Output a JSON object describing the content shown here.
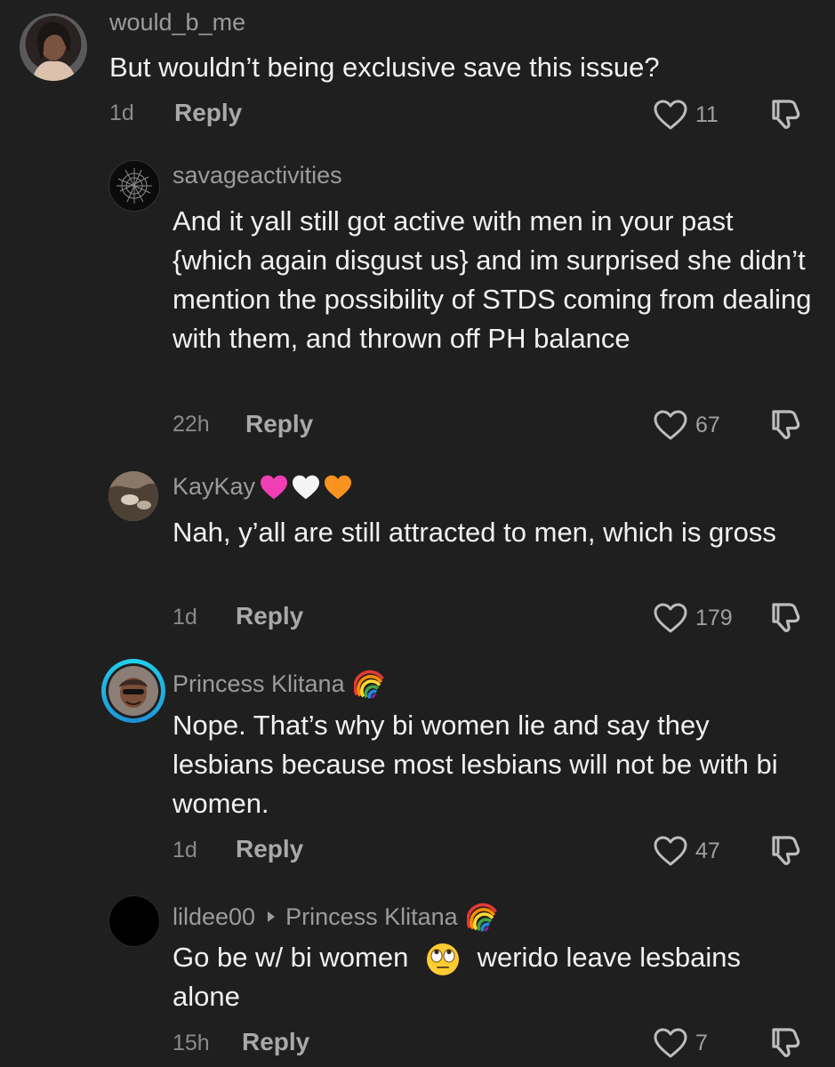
{
  "comments": [
    {
      "username": "would_b_me",
      "text": "But wouldn’t being exclusive save this issue?",
      "time": "1d",
      "reply_label": "Reply",
      "likes": "11"
    },
    {
      "username": "savageactivities",
      "text": "And it yall still got active with men in your past {which again disgust us} and im surprised she didn’t mention the possibility of STDS coming from dealing with them, and thrown off PH balance",
      "time": "22h",
      "reply_label": "Reply",
      "likes": "67"
    },
    {
      "username": "KayKay",
      "username_emojis": [
        "pink-heart",
        "white-heart",
        "orange-heart"
      ],
      "text": "Nah, y’all are still attracted to men, which is gross",
      "time": "1d",
      "reply_label": "Reply",
      "likes": "179"
    },
    {
      "username": "Princess Klitana",
      "username_emoji": "rainbow",
      "text": "Nope. That’s why bi women lie and say they lesbians because most lesbians will not be with bi women.",
      "time": "1d",
      "reply_label": "Reply",
      "likes": "47"
    },
    {
      "username": "lildee00",
      "reply_to": "Princess Klitana",
      "username_emoji": "rainbow",
      "text_before": "Go be w/ bi women",
      "text_emoji": "face-with-rolling-eyes",
      "text_after": "werido leave lesbains alone",
      "time": "15h",
      "reply_label": "Reply",
      "likes": "7"
    }
  ],
  "colors": {
    "background": "#1f1f1f",
    "username": "#9b9b9b",
    "text": "#f1f1f1",
    "meta": "#8a8a8a",
    "story_ring_start": "#22d3ee",
    "story_ring_end": "#1d8fd6"
  }
}
